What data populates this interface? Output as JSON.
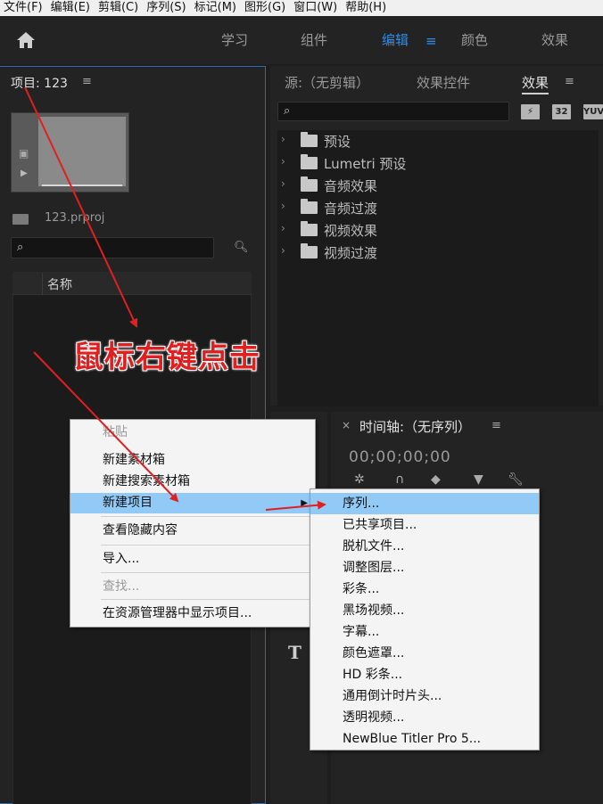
{
  "menubar": [
    "文件(F)",
    "编辑(E)",
    "剪辑(C)",
    "序列(S)",
    "标记(M)",
    "图形(G)",
    "窗口(W)",
    "帮助(H)"
  ],
  "workspace": {
    "tabs": [
      "学习",
      "组件",
      "编辑",
      "颜色",
      "效果"
    ],
    "active": "编辑",
    "menu_glyph": "≡"
  },
  "project": {
    "title": "项目: 123",
    "menu_glyph": "≡",
    "file_name": "123.prproj",
    "search_placeholder": "",
    "column_name": "名称"
  },
  "effects_panel": {
    "tabs": [
      "源:（无剪辑）",
      "效果控件",
      "效果"
    ],
    "active_tab": "效果",
    "menu_glyph": "≡",
    "badges": [
      "32",
      "YUV"
    ],
    "tree": [
      "预设",
      "Lumetri 预设",
      "音频效果",
      "音频过渡",
      "视频效果",
      "视频过渡"
    ]
  },
  "timeline": {
    "close_glyph": "×",
    "title": "时间轴:（无序列）",
    "menu_glyph": "≡",
    "timecode": "00;00;00;00",
    "text_tool_glyph": "T"
  },
  "context_menu": {
    "items": [
      "粘贴",
      "新建素材箱",
      "新建搜索素材箱",
      "新建项目",
      "查看隐藏内容",
      "导入...",
      "查找...",
      "在资源管理器中显示项目..."
    ],
    "highlighted": "新建项目"
  },
  "submenu": {
    "items": [
      "序列...",
      "已共享项目...",
      "脱机文件...",
      "调整图层...",
      "彩条...",
      "黑场视频...",
      "字幕...",
      "颜色遮罩...",
      "HD 彩条...",
      "通用倒计时片头...",
      "透明视频...",
      "NewBlue Titler Pro 5..."
    ],
    "highlighted": "序列..."
  },
  "annotation": {
    "text": "鼠标右键点击",
    "color": "#e02020"
  },
  "colors": {
    "accent": "#2d8ceb",
    "menu_highlight": "#91c9f7",
    "panel_bg": "#232323"
  }
}
